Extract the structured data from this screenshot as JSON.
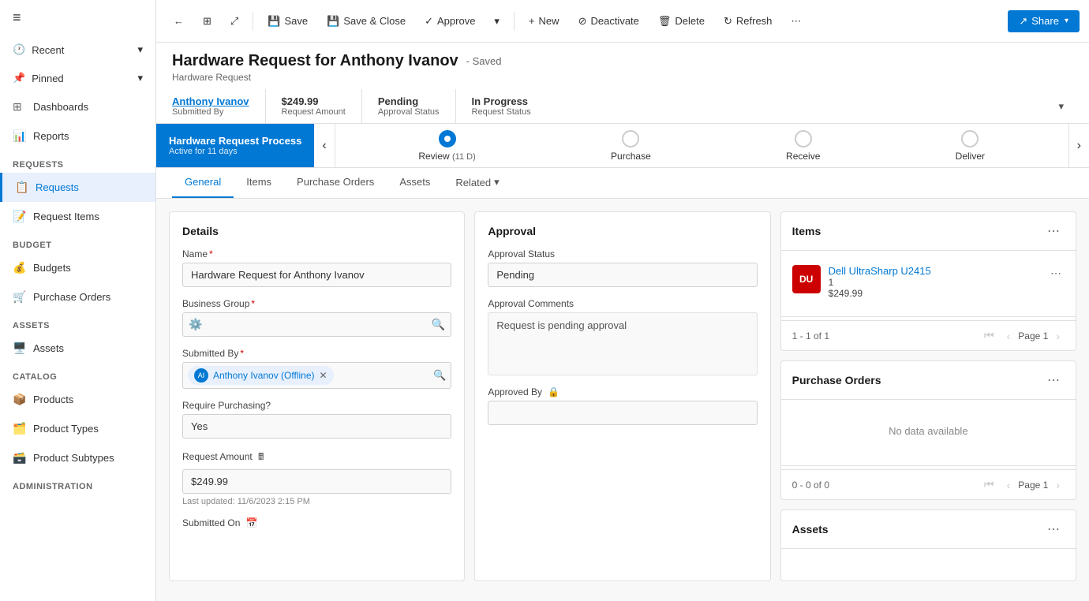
{
  "sidebar": {
    "menu_icon": "≡",
    "sections": [
      {
        "items": [
          {
            "id": "recent",
            "label": "Recent",
            "icon": "🕐",
            "expandable": true
          },
          {
            "id": "pinned",
            "label": "Pinned",
            "icon": "📌",
            "expandable": true
          }
        ]
      },
      {
        "title": "",
        "items": [
          {
            "id": "dashboards",
            "label": "Dashboards",
            "icon": "⊞",
            "expandable": false
          },
          {
            "id": "reports",
            "label": "Reports",
            "icon": "📊",
            "expandable": false
          }
        ]
      },
      {
        "title": "Requests",
        "items": [
          {
            "id": "requests",
            "label": "Requests",
            "icon": "📋",
            "active": true
          },
          {
            "id": "request-items",
            "label": "Request Items",
            "icon": "📝"
          }
        ]
      },
      {
        "title": "Budget",
        "items": [
          {
            "id": "budgets",
            "label": "Budgets",
            "icon": "💰"
          },
          {
            "id": "purchase-orders",
            "label": "Purchase Orders",
            "icon": "🛒"
          }
        ]
      },
      {
        "title": "Assets",
        "items": [
          {
            "id": "assets",
            "label": "Assets",
            "icon": "🖥️"
          }
        ]
      },
      {
        "title": "Catalog",
        "items": [
          {
            "id": "products",
            "label": "Products",
            "icon": "📦"
          },
          {
            "id": "product-types",
            "label": "Product Types",
            "icon": "🗂️"
          },
          {
            "id": "product-subtypes",
            "label": "Product Subtypes",
            "icon": "🗃️"
          }
        ]
      },
      {
        "title": "Administration",
        "items": []
      }
    ]
  },
  "toolbar": {
    "back_icon": "←",
    "grid_icon": "⊞",
    "expand_icon": "⤢",
    "save_label": "Save",
    "save_close_label": "Save & Close",
    "approve_label": "Approve",
    "approve_dropdown": "▾",
    "new_label": "New",
    "deactivate_label": "Deactivate",
    "delete_label": "Delete",
    "refresh_label": "Refresh",
    "more_icon": "⋯",
    "share_label": "Share",
    "share_dropdown": "▾"
  },
  "record": {
    "title": "Hardware Request for Anthony Ivanov",
    "saved_status": "- Saved",
    "record_type": "Hardware Request",
    "submitted_by_label": "Submitted By",
    "submitted_by_value": "Anthony Ivanov",
    "request_amount_label": "Request Amount",
    "request_amount_value": "$249.99",
    "approval_status_label": "Approval Status",
    "approval_status_value": "Pending",
    "request_status_label": "Request Status",
    "request_status_value": "In Progress",
    "expand_icon": "▾"
  },
  "process": {
    "stage_name": "Hardware Request Process",
    "stage_active": "Active for 11 days",
    "steps": [
      {
        "id": "review",
        "label": "Review",
        "sub": "(11 D)",
        "active": true
      },
      {
        "id": "purchase",
        "label": "Purchase",
        "sub": "",
        "active": false
      },
      {
        "id": "receive",
        "label": "Receive",
        "sub": "",
        "active": false
      },
      {
        "id": "deliver",
        "label": "Deliver",
        "sub": "",
        "active": false
      }
    ],
    "prev_icon": "‹",
    "next_icon": "›"
  },
  "tabs": [
    {
      "id": "general",
      "label": "General",
      "active": true
    },
    {
      "id": "items",
      "label": "Items",
      "active": false
    },
    {
      "id": "purchase-orders",
      "label": "Purchase Orders",
      "active": false
    },
    {
      "id": "assets",
      "label": "Assets",
      "active": false
    },
    {
      "id": "related",
      "label": "Related",
      "dropdown": true,
      "active": false
    }
  ],
  "details": {
    "section_title": "Details",
    "name_label": "Name",
    "name_required": true,
    "name_value": "Hardware Request for Anthony Ivanov",
    "business_group_label": "Business Group",
    "business_group_required": true,
    "business_group_icon": "🔍",
    "business_group_lookup_icon": "⚙️",
    "submitted_by_label": "Submitted By",
    "submitted_by_required": true,
    "submitted_by_user": "Anthony Ivanov (Offline)",
    "submitted_by_initials": "AI",
    "require_purchasing_label": "Require Purchasing?",
    "require_purchasing_value": "Yes",
    "request_amount_label": "Request Amount",
    "request_amount_calc_icon": "🖩",
    "request_amount_value": "$249.99",
    "last_updated_label": "Last updated:",
    "last_updated_value": "11/6/2023 2:15 PM",
    "submitted_on_label": "Submitted On"
  },
  "approval": {
    "section_title": "Approval",
    "approval_status_label": "Approval Status",
    "approval_status_value": "Pending",
    "approval_comments_label": "Approval Comments",
    "approval_comments_value": "Request is pending approval",
    "approved_by_label": "Approved By",
    "approved_by_icon": "🔒"
  },
  "items_panel": {
    "title": "Items",
    "item": {
      "initials": "DU",
      "name": "Dell UltraSharp U2415",
      "qty": "1",
      "price": "$249.99"
    },
    "pagination": {
      "count": "1 - 1 of 1",
      "page_label": "Page 1"
    }
  },
  "purchase_orders_panel": {
    "title": "Purchase Orders",
    "no_data": "No data available",
    "pagination": {
      "count": "0 - 0 of 0",
      "page_label": "Page 1"
    }
  },
  "assets_panel": {
    "title": "Assets"
  }
}
